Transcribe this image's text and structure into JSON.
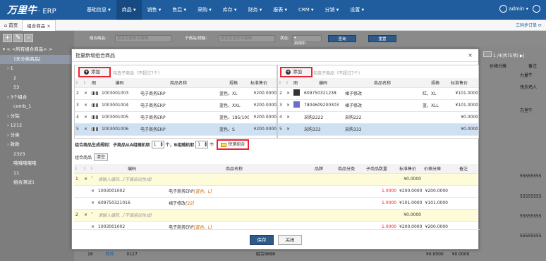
{
  "app": {
    "logo": "万里牛",
    "logo_suffix": "· ERP",
    "menu": [
      "基础信息",
      "商品",
      "销售",
      "售后",
      "采购",
      "库存",
      "财务",
      "报表",
      "CRM",
      "分销",
      "设置"
    ],
    "active_menu": 1,
    "user": "admin"
  },
  "tabs": {
    "home": "首页",
    "current": "组合商品",
    "close": "×",
    "right_link": "三同步订单"
  },
  "sidebar": {
    "items": [
      "< <所有组合商品> >",
      "[未分类商品]",
      "1",
      "2",
      "53",
      "3个组合",
      "comb_1",
      "分院",
      "1212",
      "分类",
      "款款",
      "2323",
      "哦哦哦哦哦",
      "11",
      "组合测试1"
    ]
  },
  "filter": {
    "label1": "组合商品:",
    "placeholder1": "按名空值来可编辑",
    "label2": "子商品/规格:",
    "placeholder2": "按名空值来可编辑",
    "status_label": "状态:",
    "status_value": "启用中",
    "query": "查询",
    "reset": "重置"
  },
  "background": {
    "pager": "1 /4(共75项)",
    "col_price": "价格分摊",
    "col_remark": "备注",
    "right_cells": [
      "力量牛",
      "快乐鸡人",
      "万里牛",
      "55555555",
      "55555555",
      "55555555",
      "55555555"
    ],
    "bottom_row": {
      "no": "16",
      "edit": "修改",
      "code": "0127",
      "name": "组合9898",
      "price1": "¥0.0000",
      "price2": "¥0.0000"
    }
  },
  "modal": {
    "title": "批量新增组合商品",
    "close": "×",
    "add_label": "添加",
    "left_hint": "勾选子商品（不超过7个）",
    "right_hint": "勾选子商品（不超过7个）",
    "headers": {
      "code": "编码",
      "name": "商品名称",
      "spec": "规格",
      "price": "标准售价",
      "img": "图"
    },
    "left_rows": [
      {
        "no": "2",
        "code": "1003001003",
        "name": "电子商务ERP",
        "spec": "蓝色，XL",
        "price": "¥200.0000"
      },
      {
        "no": "3",
        "code": "1003001004",
        "name": "电子商务ERP",
        "spec": "蓝色，XXL",
        "price": "¥200.0000"
      },
      {
        "no": "4",
        "code": "1003001005",
        "name": "电子商务ERP",
        "spec": "蓝色，185/100",
        "price": "¥200.0000"
      },
      {
        "no": "5",
        "code": "1003001006",
        "name": "电子商务ERP",
        "spec": "蓝色，S",
        "price": "¥200.0000"
      }
    ],
    "right_rows": [
      {
        "no": "2",
        "code": "609750321238",
        "name": "裙子修改",
        "spec": "红，XL",
        "price": "¥101.0000"
      },
      {
        "no": "3",
        "code": "7804609200303",
        "name": "裙子修改",
        "spec": "蓝，XLL",
        "price": "¥101.0000"
      },
      {
        "no": "4",
        "code": "采购2222",
        "name": "采购222",
        "spec": "",
        "price": "¥0.0000"
      },
      {
        "no": "5",
        "code": "采购333",
        "name": "采购333",
        "spec": "",
        "price": "¥0.0000"
      }
    ],
    "rule_prefix": "组合商品生成规则：子商品从A组随机取",
    "rule_a": "1",
    "rule_mid": "个，B组随机取",
    "rule_b": "1",
    "rule_suffix": "个",
    "quick_btn": "快速组合",
    "combo_label": "组合商品",
    "clear_btn": "清空",
    "combo_headers": {
      "code": "编码",
      "name": "商品名称",
      "brand": "品牌",
      "category": "商品分类",
      "qty": "子商品数量",
      "price": "标准售价",
      "share": "价格分摊",
      "remark": "备注"
    },
    "combo_groups": [
      {
        "no": "1",
        "code_hint": "请输入编码...(不填自动生成)",
        "name_hint": "请输入名称...",
        "price": "¥0.0000",
        "children": [
          {
            "code": "1003001002",
            "name": "电子商务ERP",
            "spec": "[蓝色，L]",
            "qty": "1.0000",
            "price": "¥200.0000",
            "share": "¥200.0000"
          },
          {
            "code": "609750321016",
            "name": "裙子修改",
            "spec": "[22]",
            "qty": "1.0000",
            "price": "¥101.0000",
            "share": "¥101.0000"
          }
        ]
      },
      {
        "no": "2",
        "code_hint": "请输入编码...(不填自动生成)",
        "name_hint": "请输入名称...",
        "price": "¥0.0000",
        "children": [
          {
            "code": "1003001002",
            "name": "电子商务ERP",
            "spec": "[蓝色，L]",
            "qty": "1.0000",
            "price": "¥200.0000",
            "share": "¥200.0000"
          }
        ]
      }
    ],
    "save": "保存",
    "close_btn": "关闭"
  }
}
